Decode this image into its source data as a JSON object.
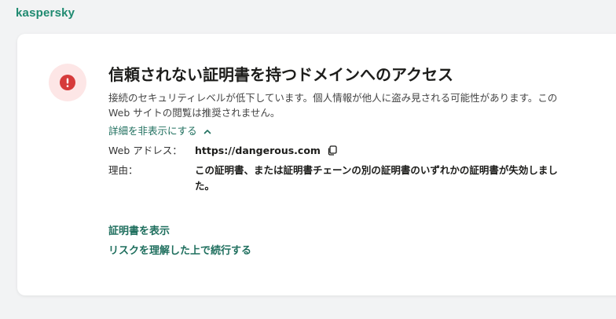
{
  "colors": {
    "brand": "#1f8a70",
    "link": "#1f6f5e",
    "alert_red": "#d63b3b",
    "alert_bg": "#fde6e6"
  },
  "logo": {
    "text": "kaspersky"
  },
  "alert": {
    "icon": "exclamation-icon",
    "title": "信頼されない証明書を持つドメインへのアクセス",
    "description": "接続のセキュリティレベルが低下しています。個人情報が他人に盗み見される可能性があります。この Web サイトの閲覧は推奨されません。",
    "toggle_label": "詳細を非表示にする",
    "details": {
      "web_address_label": "Web アドレス：",
      "web_address_value": "https://dangerous.com",
      "reason_label": "理由：",
      "reason_value": "この証明書、または証明書チェーンの別の証明書のいずれかの証明書が失効しました。"
    },
    "actions": {
      "show_certificate": "証明書を表示",
      "continue_anyway": "リスクを理解した上で続行する"
    }
  }
}
